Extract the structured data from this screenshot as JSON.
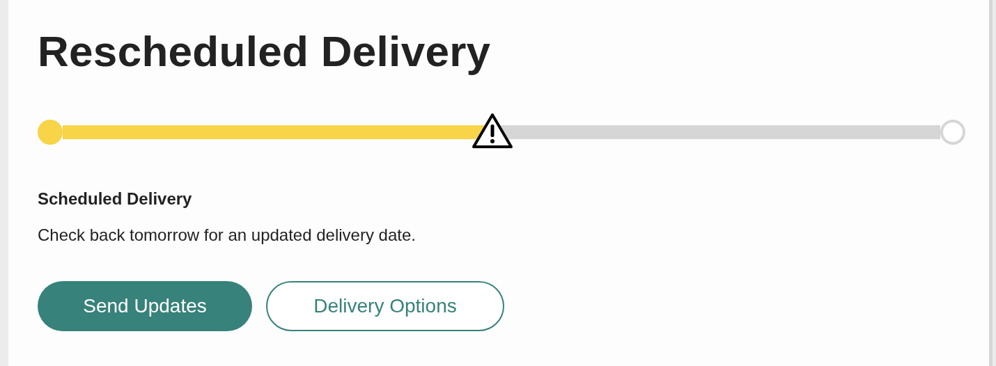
{
  "title": "Rescheduled Delivery",
  "progress": {
    "level": 0.49
  },
  "status": {
    "heading": "Scheduled Delivery",
    "message": "Check back tomorrow for an updated delivery date."
  },
  "buttons": [
    {
      "label": "Send Updates",
      "kind": "primary"
    },
    {
      "label": "Delivery Options",
      "kind": "secondary"
    }
  ]
}
